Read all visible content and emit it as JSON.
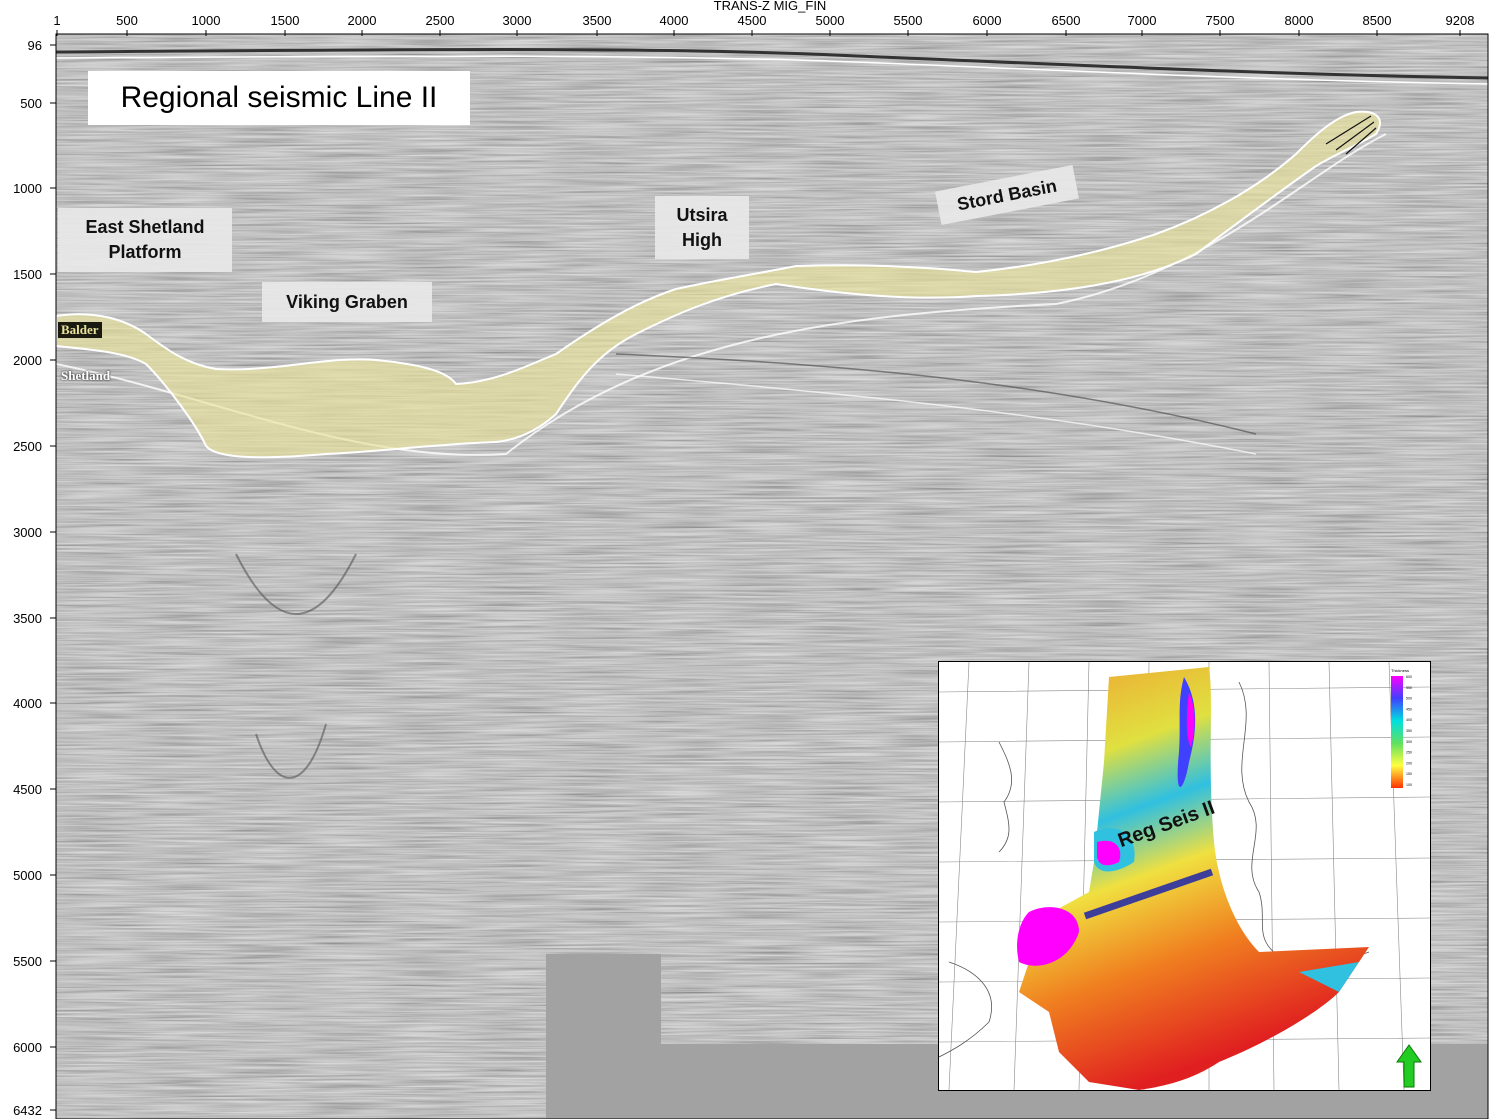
{
  "header": {
    "section_title": "TRANS-Z MIG_FIN"
  },
  "x_axis": {
    "ticks": [
      "1",
      "500",
      "1000",
      "1500",
      "2000",
      "2500",
      "3000",
      "3500",
      "4000",
      "4500",
      "5000",
      "5500",
      "6000",
      "6500",
      "7000",
      "7500",
      "8000",
      "8500",
      "9208"
    ]
  },
  "y_axis": {
    "ticks": [
      "96",
      "500",
      "1000",
      "1500",
      "2000",
      "2500",
      "3000",
      "3500",
      "4000",
      "4500",
      "5000",
      "5500",
      "6000",
      "6432"
    ]
  },
  "title": "Regional seismic Line II",
  "labels": {
    "east_shetland": [
      "East Shetland",
      "Platform"
    ],
    "viking_graben": "Viking Graben",
    "utsira_high": [
      "Utsira",
      "High"
    ],
    "stord_basin": "Stord Basin",
    "balder": "Balder",
    "shetland": "Shetland"
  },
  "colors": {
    "balder_fill": "#e8e29a",
    "seismic_background": "#a9a9a9",
    "section_line": "#3d3d9a",
    "north_arrow": "#22cc22"
  },
  "inset": {
    "line_label": "Reg Seis II",
    "legend_title": "Thickness",
    "legend_ticks": [
      "600",
      "550",
      "500",
      "450",
      "400",
      "350",
      "300",
      "250",
      "200",
      "150",
      "100"
    ],
    "north_arrow_icon": "north-arrow-icon"
  }
}
